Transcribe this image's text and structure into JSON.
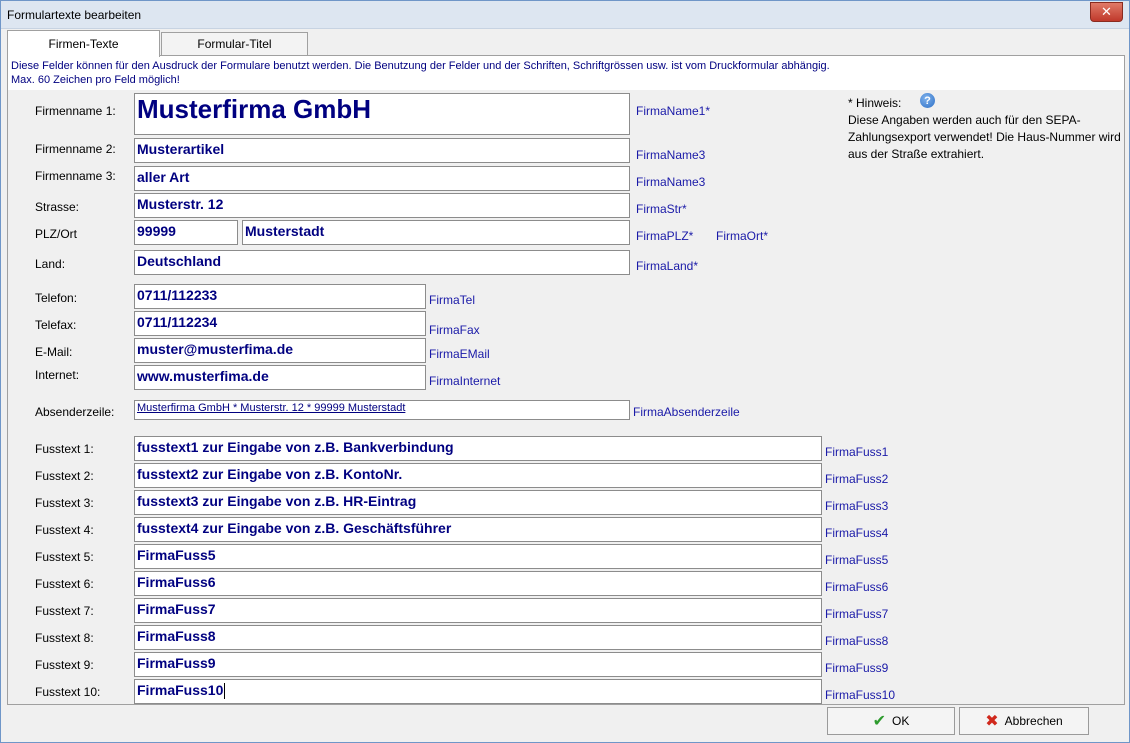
{
  "window": {
    "title": "Formulartexte bearbeiten",
    "close": "✕"
  },
  "tabs": [
    {
      "label": "Firmen-Texte"
    },
    {
      "label": "Formular-Titel"
    }
  ],
  "info": {
    "line1": "Diese Felder können für den Ausdruck der Formulare benutzt werden. Die Benutzung der Felder und der Schriften, Schriftgrössen usw. ist vom Druckformular abhängig.",
    "line2": "Max. 60 Zeichen pro Feld möglich!"
  },
  "hint": {
    "title": "* Hinweis:",
    "text": "Diese Angaben werden auch für den SEPA-Zahlungsexport verwendet! Die Haus-Nummer wird aus der Straße extrahiert."
  },
  "fields": {
    "firmenname1": {
      "label": "Firmenname 1:",
      "value": "Musterfirma GmbH",
      "tag": "FirmaName1*"
    },
    "firmenname2": {
      "label": "Firmenname 2:",
      "value": "Musterartikel",
      "tag": "FirmaName3"
    },
    "firmenname3": {
      "label": "Firmenname 3:",
      "value": "aller Art",
      "tag": "FirmaName3"
    },
    "strasse": {
      "label": "Strasse:",
      "value": "Musterstr. 12",
      "tag": "FirmaStr*"
    },
    "plzort": {
      "label": "PLZ/Ort",
      "plz": "99999",
      "ort": "Musterstadt",
      "tag_plz": "FirmaPLZ*",
      "tag_ort": "FirmaOrt*"
    },
    "land": {
      "label": "Land:",
      "value": "Deutschland",
      "tag": "FirmaLand*"
    },
    "telefon": {
      "label": "Telefon:",
      "value": "0711/112233",
      "tag": "FirmaTel"
    },
    "telefax": {
      "label": "Telefax:",
      "value": "0711/112234",
      "tag": "FirmaFax"
    },
    "email": {
      "label": "E-Mail:",
      "value": "muster@musterfima.de",
      "tag": "FirmaEMail"
    },
    "internet": {
      "label": "Internet:",
      "value": "www.musterfima.de",
      "tag": "FirmaInternet"
    },
    "absender": {
      "label": "Absenderzeile:",
      "value": "Musterfirma GmbH * Musterstr. 12 * 99999 Musterstadt",
      "tag": "FirmaAbsenderzeile"
    }
  },
  "fuss": [
    {
      "label": "Fusstext 1:",
      "value": "fusstext1 zur Eingabe von z.B. Bankverbindung",
      "tag": "FirmaFuss1"
    },
    {
      "label": "Fusstext 2:",
      "value": "fusstext2 zur Eingabe von z.B. KontoNr.",
      "tag": "FirmaFuss2"
    },
    {
      "label": "Fusstext 3:",
      "value": "fusstext3 zur Eingabe von z.B. HR-Eintrag",
      "tag": "FirmaFuss3"
    },
    {
      "label": "Fusstext 4:",
      "value": "fusstext4 zur Eingabe von z.B. Geschäftsführer",
      "tag": "FirmaFuss4"
    },
    {
      "label": "Fusstext 5:",
      "value": "FirmaFuss5",
      "tag": "FirmaFuss5"
    },
    {
      "label": "Fusstext 6:",
      "value": "FirmaFuss6",
      "tag": "FirmaFuss6"
    },
    {
      "label": "Fusstext 7:",
      "value": "FirmaFuss7",
      "tag": "FirmaFuss7"
    },
    {
      "label": "Fusstext 8:",
      "value": "FirmaFuss8",
      "tag": "FirmaFuss8"
    },
    {
      "label": "Fusstext 9:",
      "value": "FirmaFuss9",
      "tag": "FirmaFuss9"
    },
    {
      "label": "Fusstext 10:",
      "value": "FirmaFuss10",
      "tag": "FirmaFuss10"
    }
  ],
  "buttons": {
    "ok": "OK",
    "cancel": "Abbrechen"
  },
  "icons": {
    "ok": "check-icon",
    "cancel": "cross-icon",
    "help": "help-icon"
  },
  "colors": {
    "field_text": "#000080",
    "tag_text": "#1a1aa8",
    "title_bar": "#dde6f1"
  }
}
